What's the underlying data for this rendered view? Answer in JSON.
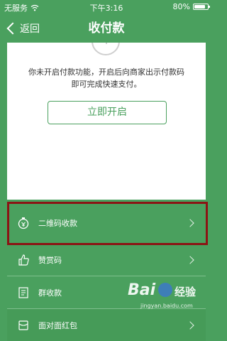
{
  "status_bar": {
    "carrier": "无服务",
    "time": "下午3:16",
    "battery": "80%"
  },
  "nav": {
    "back_label": "返回",
    "title": "收付款"
  },
  "card": {
    "message_line1": "你未开启付款功能，开启后向商家出示付款码",
    "message_line2": "即可完成快速支付。",
    "open_button": "立即开启"
  },
  "menu": {
    "items": [
      {
        "label": "二维码收款",
        "icon": "stopwatch-money-icon"
      },
      {
        "label": "赞赏码",
        "icon": "thumbs-up-icon"
      },
      {
        "label": "群收款",
        "icon": "document-list-icon"
      },
      {
        "label": "面对面红包",
        "icon": "red-packet-icon"
      }
    ]
  },
  "watermark": {
    "logo": "Bai",
    "logo_suffix": "经验",
    "url": "jingyan.baidu.com"
  },
  "colors": {
    "background": "#4aa05e",
    "highlight_border": "#8b1414",
    "card": "#ffffff"
  }
}
